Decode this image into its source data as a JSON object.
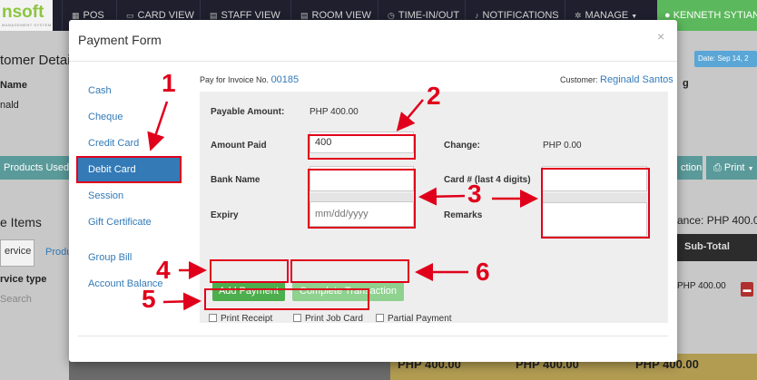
{
  "app": {
    "logo": "nsoft",
    "logo_sub": "MANAGEMENT SYSTEM",
    "nav": [
      {
        "label": "POS",
        "icon": "grid-icon"
      },
      {
        "label": "CARD VIEW",
        "icon": "card-icon"
      },
      {
        "label": "STAFF VIEW",
        "icon": "calendar-icon"
      },
      {
        "label": "ROOM VIEW",
        "icon": "calendar-icon"
      },
      {
        "label": "TIME-IN/OUT",
        "icon": "clock-icon"
      },
      {
        "label": "NOTIFICATIONS",
        "icon": "bell-icon"
      },
      {
        "label": "MANAGE",
        "icon": "gear-icon"
      }
    ],
    "user": "KENNETH SYTIAN",
    "bg": {
      "customer_details": "tomer Details",
      "name_col": "Name",
      "name_val": "nald",
      "products_used": "Products Used",
      "items_title": "e Items",
      "tab_service": "ervice",
      "tab_product": "Produ",
      "service_type": "rvice type",
      "search": "Search",
      "date_badge": "Date: Sep 14, 2",
      "right_letter": "g",
      "action": "ction",
      "print": "Print",
      "balance": "ance: PHP 400.0",
      "subtotal": "Sub-Total",
      "row_amount": "PHP 400.00",
      "bottom_amounts": [
        "PHP 400.00",
        "PHP 400.00",
        "PHP 400.00"
      ]
    }
  },
  "modal": {
    "title": "Payment Form",
    "close": "×",
    "methods": [
      "Cash",
      "Cheque",
      "Credit Card",
      "Debit Card",
      "Session",
      "Gift Certificate",
      "Group Bill",
      "Account Balance"
    ],
    "active_method": "Debit Card",
    "invoice_label": "Pay for Invoice No.",
    "invoice_no": "00185",
    "customer_label": "Customer:",
    "customer_name": "Reginald Santos",
    "payable_label": "Payable Amount:",
    "payable_value": "PHP 400.00",
    "amount_paid_label": "Amount Paid",
    "amount_paid_value": "400",
    "change_label": "Change:",
    "change_value": "PHP 0.00",
    "bank_name_label": "Bank Name",
    "bank_name_value": "",
    "card_label": "Card # (last 4 digits)",
    "card_value": "",
    "expiry_label": "Expiry",
    "expiry_placeholder": "mm/dd/yyyy",
    "remarks_label": "Remarks",
    "remarks_value": "",
    "add_payment": "Add Payment",
    "complete_transaction": "Complete Transaction",
    "print_receipt": "Print Receipt",
    "print_job_card": "Print Job Card",
    "partial_payment": "Partial Payment"
  },
  "annotations": [
    "1",
    "2",
    "3",
    "4",
    "5",
    "6"
  ],
  "colors": {
    "annotation_red": "#e0001b",
    "primary_blue": "#337ab7",
    "add_green": "#4cae4c",
    "complete_green": "#8fd18f",
    "topbar": "#1f1f2e"
  }
}
